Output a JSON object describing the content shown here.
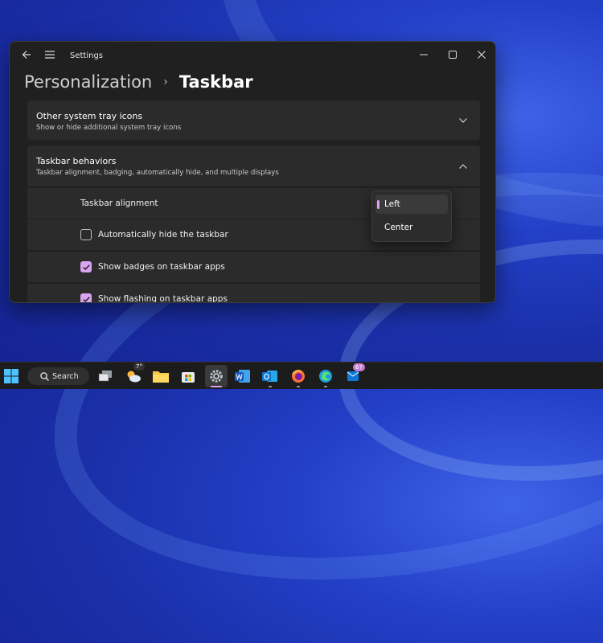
{
  "window": {
    "app_title": "Settings",
    "breadcrumb_parent": "Personalization",
    "breadcrumb_separator": "›",
    "breadcrumb_current": "Taskbar"
  },
  "sections": {
    "tray": {
      "title": "Other system tray icons",
      "description": "Show or hide additional system tray icons",
      "expanded": false
    },
    "behaviors": {
      "title": "Taskbar behaviors",
      "description": "Taskbar alignment, badging, automatically hide, and multiple displays",
      "expanded": true
    }
  },
  "settings": {
    "alignment_label": "Taskbar alignment",
    "auto_hide": {
      "label": "Automatically hide the taskbar",
      "checked": false
    },
    "badges": {
      "label": "Show badges on taskbar apps",
      "checked": true
    },
    "flashing": {
      "label": "Show flashing on taskbar apps",
      "checked": true
    }
  },
  "alignment_dropdown": {
    "options": [
      "Left",
      "Center"
    ],
    "selected": "Left"
  },
  "taskbar": {
    "search_label": "Search",
    "weather_temp": "7°",
    "mail_badge": "67"
  },
  "colors": {
    "accent": "#d9a3f0",
    "window_bg": "#202020",
    "card_bg": "#2b2b2b",
    "taskbar_bg": "#1c1c1c"
  },
  "icons": [
    "back-arrow-icon",
    "hamburger-menu-icon",
    "minimize-icon",
    "maximize-icon",
    "close-icon",
    "chevron-down-icon",
    "chevron-up-icon",
    "checkmark-icon",
    "start-icon",
    "search-icon",
    "task-view-icon",
    "weather-icon",
    "file-explorer-icon",
    "store-icon",
    "settings-gear-icon",
    "word-icon",
    "outlook-icon",
    "firefox-icon",
    "edge-icon",
    "mail-icon"
  ]
}
